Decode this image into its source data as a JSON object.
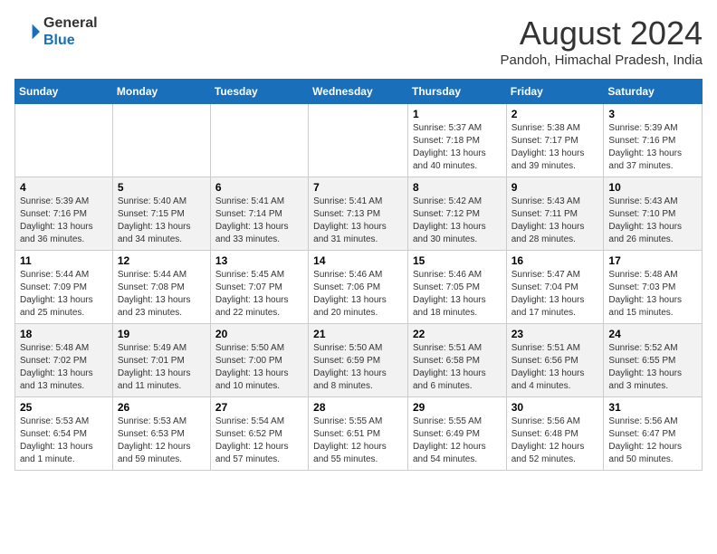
{
  "header": {
    "logo_line1": "General",
    "logo_line2": "Blue",
    "month_year": "August 2024",
    "location": "Pandoh, Himachal Pradesh, India"
  },
  "weekdays": [
    "Sunday",
    "Monday",
    "Tuesday",
    "Wednesday",
    "Thursday",
    "Friday",
    "Saturday"
  ],
  "weeks": [
    [
      {
        "day": "",
        "info": ""
      },
      {
        "day": "",
        "info": ""
      },
      {
        "day": "",
        "info": ""
      },
      {
        "day": "",
        "info": ""
      },
      {
        "day": "1",
        "info": "Sunrise: 5:37 AM\nSunset: 7:18 PM\nDaylight: 13 hours\nand 40 minutes."
      },
      {
        "day": "2",
        "info": "Sunrise: 5:38 AM\nSunset: 7:17 PM\nDaylight: 13 hours\nand 39 minutes."
      },
      {
        "day": "3",
        "info": "Sunrise: 5:39 AM\nSunset: 7:16 PM\nDaylight: 13 hours\nand 37 minutes."
      }
    ],
    [
      {
        "day": "4",
        "info": "Sunrise: 5:39 AM\nSunset: 7:16 PM\nDaylight: 13 hours\nand 36 minutes."
      },
      {
        "day": "5",
        "info": "Sunrise: 5:40 AM\nSunset: 7:15 PM\nDaylight: 13 hours\nand 34 minutes."
      },
      {
        "day": "6",
        "info": "Sunrise: 5:41 AM\nSunset: 7:14 PM\nDaylight: 13 hours\nand 33 minutes."
      },
      {
        "day": "7",
        "info": "Sunrise: 5:41 AM\nSunset: 7:13 PM\nDaylight: 13 hours\nand 31 minutes."
      },
      {
        "day": "8",
        "info": "Sunrise: 5:42 AM\nSunset: 7:12 PM\nDaylight: 13 hours\nand 30 minutes."
      },
      {
        "day": "9",
        "info": "Sunrise: 5:43 AM\nSunset: 7:11 PM\nDaylight: 13 hours\nand 28 minutes."
      },
      {
        "day": "10",
        "info": "Sunrise: 5:43 AM\nSunset: 7:10 PM\nDaylight: 13 hours\nand 26 minutes."
      }
    ],
    [
      {
        "day": "11",
        "info": "Sunrise: 5:44 AM\nSunset: 7:09 PM\nDaylight: 13 hours\nand 25 minutes."
      },
      {
        "day": "12",
        "info": "Sunrise: 5:44 AM\nSunset: 7:08 PM\nDaylight: 13 hours\nand 23 minutes."
      },
      {
        "day": "13",
        "info": "Sunrise: 5:45 AM\nSunset: 7:07 PM\nDaylight: 13 hours\nand 22 minutes."
      },
      {
        "day": "14",
        "info": "Sunrise: 5:46 AM\nSunset: 7:06 PM\nDaylight: 13 hours\nand 20 minutes."
      },
      {
        "day": "15",
        "info": "Sunrise: 5:46 AM\nSunset: 7:05 PM\nDaylight: 13 hours\nand 18 minutes."
      },
      {
        "day": "16",
        "info": "Sunrise: 5:47 AM\nSunset: 7:04 PM\nDaylight: 13 hours\nand 17 minutes."
      },
      {
        "day": "17",
        "info": "Sunrise: 5:48 AM\nSunset: 7:03 PM\nDaylight: 13 hours\nand 15 minutes."
      }
    ],
    [
      {
        "day": "18",
        "info": "Sunrise: 5:48 AM\nSunset: 7:02 PM\nDaylight: 13 hours\nand 13 minutes."
      },
      {
        "day": "19",
        "info": "Sunrise: 5:49 AM\nSunset: 7:01 PM\nDaylight: 13 hours\nand 11 minutes."
      },
      {
        "day": "20",
        "info": "Sunrise: 5:50 AM\nSunset: 7:00 PM\nDaylight: 13 hours\nand 10 minutes."
      },
      {
        "day": "21",
        "info": "Sunrise: 5:50 AM\nSunset: 6:59 PM\nDaylight: 13 hours\nand 8 minutes."
      },
      {
        "day": "22",
        "info": "Sunrise: 5:51 AM\nSunset: 6:58 PM\nDaylight: 13 hours\nand 6 minutes."
      },
      {
        "day": "23",
        "info": "Sunrise: 5:51 AM\nSunset: 6:56 PM\nDaylight: 13 hours\nand 4 minutes."
      },
      {
        "day": "24",
        "info": "Sunrise: 5:52 AM\nSunset: 6:55 PM\nDaylight: 13 hours\nand 3 minutes."
      }
    ],
    [
      {
        "day": "25",
        "info": "Sunrise: 5:53 AM\nSunset: 6:54 PM\nDaylight: 13 hours\nand 1 minute."
      },
      {
        "day": "26",
        "info": "Sunrise: 5:53 AM\nSunset: 6:53 PM\nDaylight: 12 hours\nand 59 minutes."
      },
      {
        "day": "27",
        "info": "Sunrise: 5:54 AM\nSunset: 6:52 PM\nDaylight: 12 hours\nand 57 minutes."
      },
      {
        "day": "28",
        "info": "Sunrise: 5:55 AM\nSunset: 6:51 PM\nDaylight: 12 hours\nand 55 minutes."
      },
      {
        "day": "29",
        "info": "Sunrise: 5:55 AM\nSunset: 6:49 PM\nDaylight: 12 hours\nand 54 minutes."
      },
      {
        "day": "30",
        "info": "Sunrise: 5:56 AM\nSunset: 6:48 PM\nDaylight: 12 hours\nand 52 minutes."
      },
      {
        "day": "31",
        "info": "Sunrise: 5:56 AM\nSunset: 6:47 PM\nDaylight: 12 hours\nand 50 minutes."
      }
    ]
  ]
}
